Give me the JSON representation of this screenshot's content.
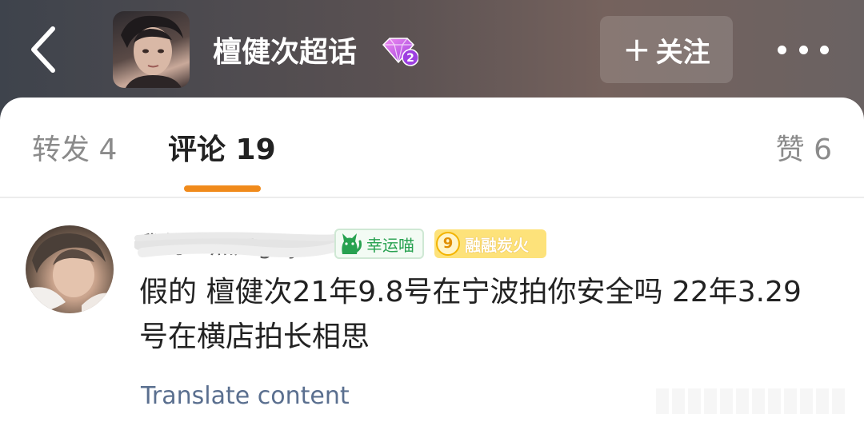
{
  "header": {
    "group_title": "檀健次超话",
    "badge_level": "2",
    "follow_label": "关注"
  },
  "tabs": {
    "repost": "转发 4",
    "comments": "评论 19",
    "likes": "赞 6"
  },
  "comment": {
    "username": "我的一点是gay",
    "badge_lucky": "幸运喵",
    "badge_fire_level": "9",
    "badge_fire_label": "融融炭火",
    "text": "假的 檀健次21年9.8号在宁波拍你安全吗 22年3.29号在横店拍长相思",
    "translate_label": "Translate content"
  },
  "colors": {
    "accent_orange": "#f08a1b",
    "link_blue": "#5a6f8f",
    "lucky_green": "#27a150",
    "fire_yellow": "#fde27a"
  }
}
